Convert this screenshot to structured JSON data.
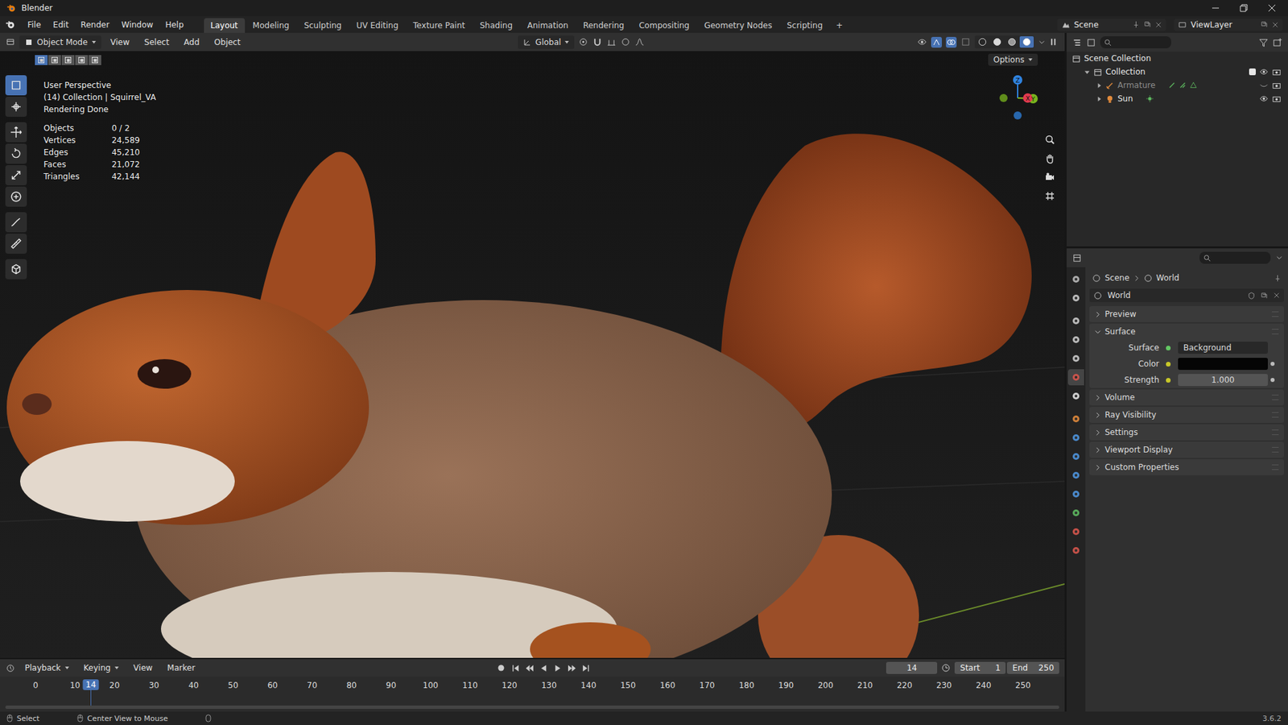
{
  "window": {
    "title": "Blender",
    "version": "3.6.2"
  },
  "menu": [
    "File",
    "Edit",
    "Render",
    "Window",
    "Help"
  ],
  "workspaces": [
    {
      "label": "Layout",
      "selected": true
    },
    {
      "label": "Modeling",
      "selected": false
    },
    {
      "label": "Sculpting",
      "selected": false
    },
    {
      "label": "UV Editing",
      "selected": false
    },
    {
      "label": "Texture Paint",
      "selected": false
    },
    {
      "label": "Shading",
      "selected": false
    },
    {
      "label": "Animation",
      "selected": false
    },
    {
      "label": "Rendering",
      "selected": false
    },
    {
      "label": "Compositing",
      "selected": false
    },
    {
      "label": "Geometry Nodes",
      "selected": false
    },
    {
      "label": "Scripting",
      "selected": false
    }
  ],
  "add_workspace": "+",
  "scene": "Scene",
  "view_layer": "ViewLayer",
  "viewport_header": {
    "mode": "Object Mode",
    "menus": [
      "View",
      "Select",
      "Add",
      "Object"
    ],
    "orientation": "Global",
    "options": "Options",
    "select_modes": [
      {
        "selected": true
      },
      {
        "selected": false
      },
      {
        "selected": false
      },
      {
        "selected": false
      },
      {
        "selected": false
      }
    ],
    "shading_modes": [
      {
        "kind": "wireframe",
        "selected": false
      },
      {
        "kind": "solid",
        "selected": false
      },
      {
        "kind": "material",
        "selected": false
      },
      {
        "kind": "rendered",
        "selected": true
      }
    ]
  },
  "tools": [
    {
      "kind": "select",
      "selected": true
    },
    {
      "kind": "cursor",
      "selected": false
    },
    {
      "kind": "move",
      "selected": false
    },
    {
      "kind": "rotate",
      "selected": false
    },
    {
      "kind": "scale",
      "selected": false
    },
    {
      "kind": "transform",
      "selected": false
    },
    {
      "kind": "annotate",
      "selected": false
    },
    {
      "kind": "measure",
      "selected": false
    },
    {
      "kind": "add_cube",
      "selected": false
    }
  ],
  "viewport_overlay": {
    "lines": [
      "User Perspective",
      "(14) Collection | Squirrel_VA",
      "Rendering Done"
    ],
    "stats": [
      {
        "label": "Objects",
        "value": "0 / 2"
      },
      {
        "label": "Vertices",
        "value": "24,589"
      },
      {
        "label": "Edges",
        "value": "45,210"
      },
      {
        "label": "Faces",
        "value": "21,072"
      },
      {
        "label": "Triangles",
        "value": "42,144"
      }
    ]
  },
  "gizmo": {
    "axes": [
      {
        "label": "Z",
        "color": "#2f83e0"
      },
      {
        "label": "X",
        "color": "#e23a4e"
      },
      {
        "label": "Y",
        "color": "#7ab51d"
      }
    ]
  },
  "outliner": {
    "items": [
      {
        "label": "Scene Collection",
        "depth": 0,
        "kind": "scene_collection",
        "expanded": true,
        "visible": true
      },
      {
        "label": "Collection",
        "depth": 1,
        "kind": "collection",
        "expanded": true,
        "visible": true,
        "checked": true
      },
      {
        "label": "Armature",
        "depth": 2,
        "kind": "armature",
        "expanded": false,
        "visible": false
      },
      {
        "label": "Sun",
        "depth": 2,
        "kind": "light",
        "expanded": false,
        "visible": true
      }
    ]
  },
  "properties": {
    "tabs": [
      {
        "kind": "tool",
        "selected": false
      },
      {
        "kind": "render",
        "selected": false
      },
      {
        "kind": "output",
        "selected": false
      },
      {
        "kind": "view_layer",
        "selected": false
      },
      {
        "kind": "scene",
        "selected": false
      },
      {
        "kind": "world",
        "selected": true
      },
      {
        "kind": "collection",
        "selected": false
      },
      {
        "kind": "object",
        "selected": false
      },
      {
        "kind": "modifiers",
        "selected": false
      },
      {
        "kind": "particles",
        "selected": false
      },
      {
        "kind": "physics",
        "selected": false
      },
      {
        "kind": "constraints",
        "selected": false
      },
      {
        "kind": "data",
        "selected": false
      },
      {
        "kind": "material",
        "selected": false
      },
      {
        "kind": "texture",
        "selected": false
      }
    ],
    "breadcrumb": [
      "Scene",
      "World"
    ],
    "datablock": "World",
    "panels": [
      {
        "label": "Preview",
        "expanded": false,
        "fields": []
      },
      {
        "label": "Surface",
        "expanded": true,
        "fields": [
          {
            "label": "Surface",
            "kind": "shader",
            "value": "Background"
          },
          {
            "label": "Color",
            "kind": "color",
            "swatch": "#050505"
          },
          {
            "label": "Strength",
            "kind": "number",
            "value": "1.000"
          }
        ]
      },
      {
        "label": "Volume",
        "expanded": false,
        "fields": []
      },
      {
        "label": "Ray Visibility",
        "expanded": false,
        "fields": []
      },
      {
        "label": "Settings",
        "expanded": false,
        "fields": []
      },
      {
        "label": "Viewport Display",
        "expanded": false,
        "fields": []
      },
      {
        "label": "Custom Properties",
        "expanded": false,
        "fields": []
      }
    ]
  },
  "timeline": {
    "menus": [
      "Playback",
      "Keying",
      "View",
      "Marker"
    ],
    "current_frame": "14",
    "start_label": "Start",
    "start": "1",
    "end_label": "End",
    "end": "250",
    "ticks": [
      "0",
      "10",
      "20",
      "30",
      "40",
      "50",
      "60",
      "70",
      "80",
      "90",
      "100",
      "110",
      "120",
      "130",
      "140",
      "150",
      "160",
      "170",
      "180",
      "190",
      "200",
      "210",
      "220",
      "230",
      "240",
      "250"
    ]
  },
  "status_bar": {
    "items": [
      "Select",
      "Center View to Mouse"
    ]
  }
}
